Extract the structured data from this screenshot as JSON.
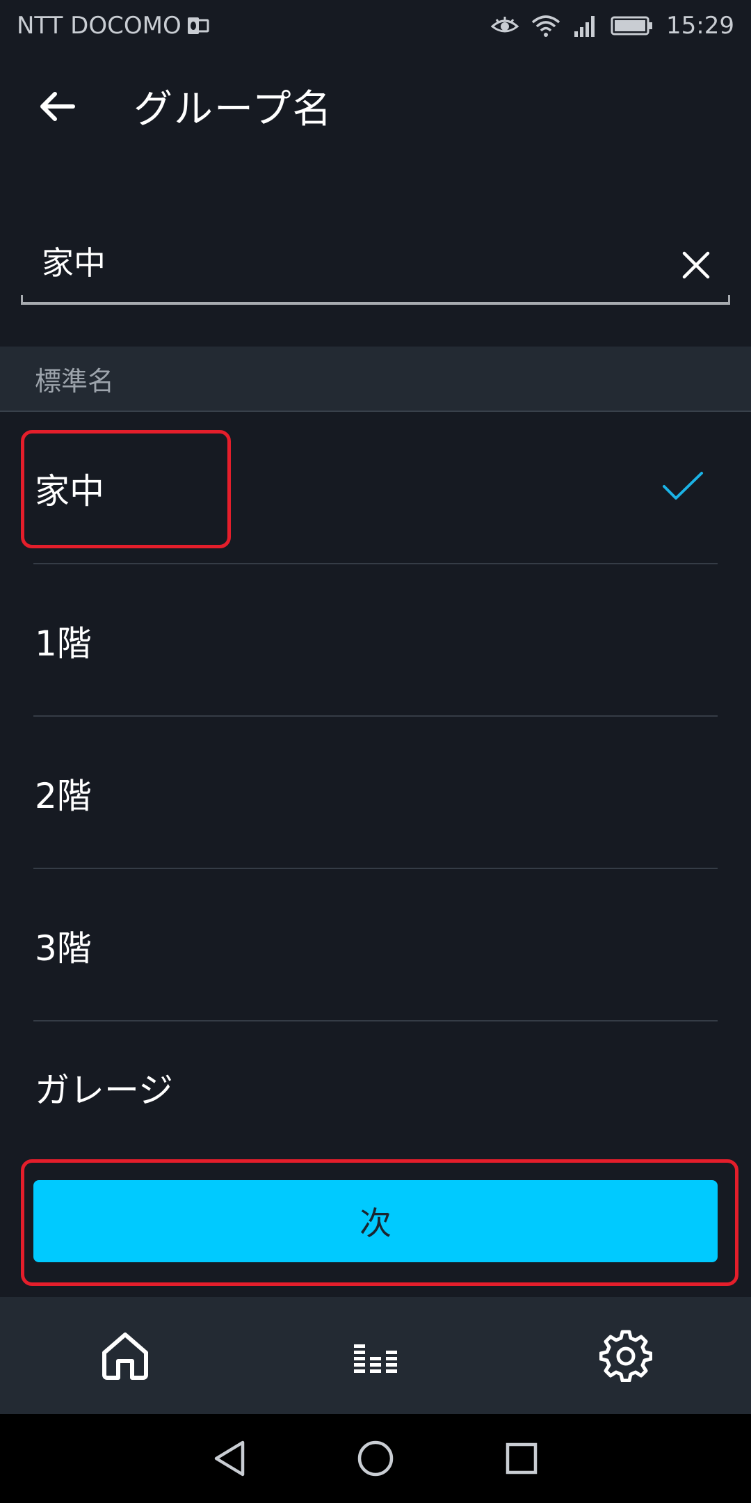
{
  "status_bar": {
    "carrier": "NTT DOCOMO",
    "time": "15:29",
    "icons": [
      "outlook-icon",
      "eye-icon",
      "wifi-icon",
      "signal-icon",
      "battery-icon"
    ]
  },
  "app_bar": {
    "title": "グループ名"
  },
  "name_field": {
    "value": "家中"
  },
  "section": {
    "header": "標準名"
  },
  "list": {
    "items": [
      {
        "label": "家中",
        "selected": true
      },
      {
        "label": "1階",
        "selected": false
      },
      {
        "label": "2階",
        "selected": false
      },
      {
        "label": "3階",
        "selected": false
      },
      {
        "label": "ガレージ",
        "selected": false
      }
    ]
  },
  "next_button": {
    "label": "次"
  },
  "bottom_nav": {
    "items": [
      "home-icon",
      "equalizer-icon",
      "gear-icon"
    ]
  },
  "colors": {
    "background": "#161a22",
    "accent": "#00caff",
    "highlight": "#e41e2b",
    "check": "#1bb3e6"
  }
}
